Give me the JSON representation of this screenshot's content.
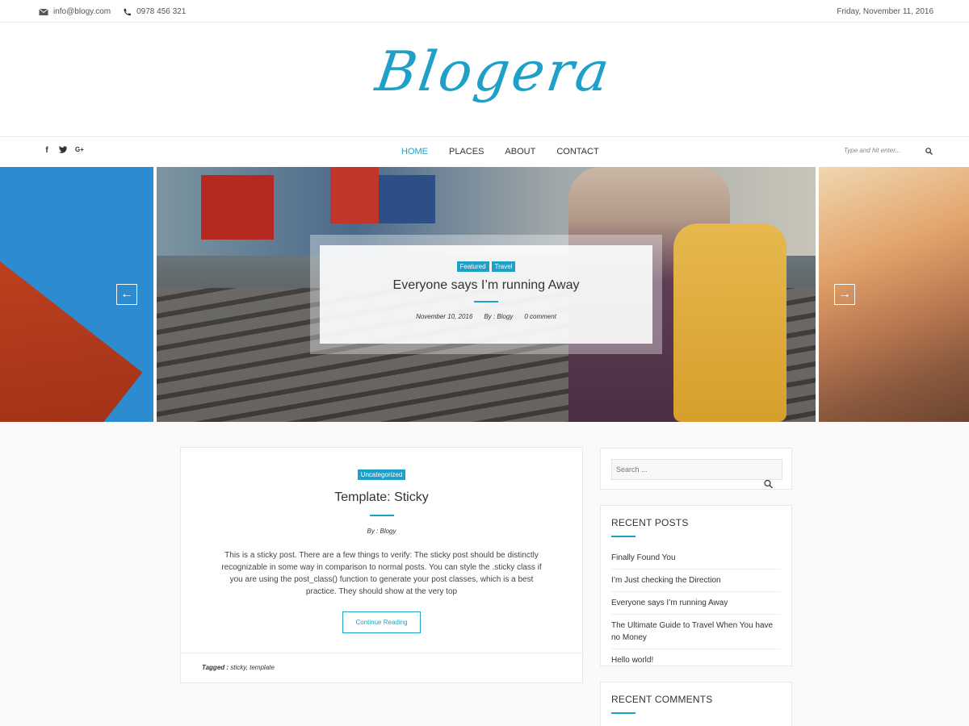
{
  "topbar": {
    "email": "info@blogy.com",
    "phone": "0978 456 321",
    "date": "Friday, November 11, 2016"
  },
  "site": {
    "logo": "Blogera"
  },
  "nav": {
    "social": [
      "f",
      "t",
      "G+"
    ],
    "menu": [
      "HOME",
      "PLACES",
      "ABOUT",
      "CONTACT"
    ],
    "active": "HOME",
    "search_placeholder": "Type and hit enter..."
  },
  "slider": {
    "tags": [
      "Featured",
      "Travel"
    ],
    "title": "Everyone says I’m running Away",
    "date": "November 10, 2016",
    "author": "By : Blogy",
    "comments": "0 comment",
    "prev_icon": "←",
    "next_icon": "→"
  },
  "post": {
    "category": "Uncategorized",
    "title": "Template: Sticky",
    "author": "By : Blogy",
    "excerpt": "This is a sticky post. There are a few things to verify: The sticky post should be distinctly recognizable in some way in comparison to normal posts. You can style the .sticky class if you are using the post_class() function to generate your post classes, which is a best practice. They should show at the very top",
    "button": "Continue Reading",
    "tagged_label": "Tagged :",
    "tags": "sticky, template"
  },
  "sidebar": {
    "search_placeholder": "Search ...",
    "recent_posts_title": "RECENT POSTS",
    "recent_posts": [
      "Finally Found You",
      "I’m Just checking the Direction",
      "Everyone says I’m running Away",
      "The Ultimate Guide to Travel When You have no Money",
      "Hello world!"
    ],
    "recent_comments_title": "RECENT COMMENTS"
  },
  "colors": {
    "accent": "#1fa0c8"
  }
}
